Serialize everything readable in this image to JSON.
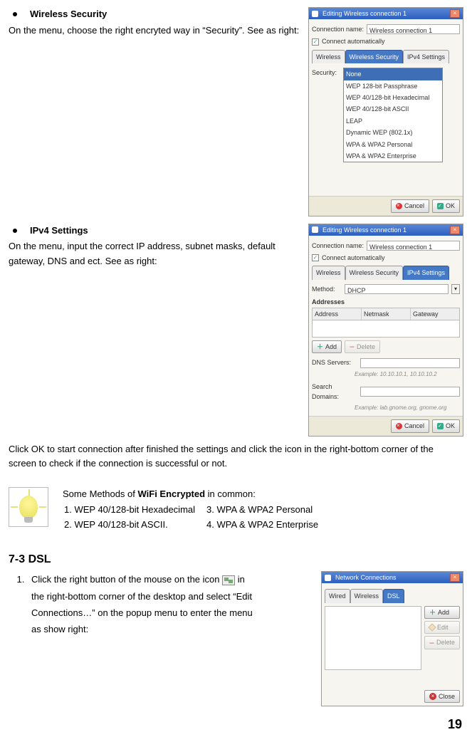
{
  "sec1": {
    "title": "Wireless Security",
    "para": "On the menu, choose the right encryted way in “Security”. See as right:",
    "shot": {
      "title": "Editing Wireless connection 1",
      "conn_label": "Connection name:",
      "conn_value": "Wireless connection 1",
      "auto": "Connect automatically",
      "tabs": [
        "Wireless",
        "Wireless Security",
        "IPv4 Settings"
      ],
      "sec_label": "Security:",
      "options": [
        "None",
        "WEP 128-bit Passphrase",
        "WEP 40/128-bit Hexadecimal",
        "WEP 40/128-bit ASCII",
        "LEAP",
        "Dynamic WEP (802.1x)",
        "WPA & WPA2 Personal",
        "WPA & WPA2 Enterprise"
      ],
      "cancel": "Cancel",
      "ok": "OK"
    }
  },
  "sec2": {
    "title": "IPv4 Settings",
    "para": "On the menu, input the correct IP address, subnet masks, default gateway, DNS and ect. See as right:",
    "shot": {
      "title": "Editing Wireless connection 1",
      "conn_label": "Connection name:",
      "conn_value": "Wireless connection 1",
      "auto": "Connect automatically",
      "tabs": [
        "Wireless",
        "Wireless Security",
        "IPv4 Settings"
      ],
      "meth_label": "Method:",
      "meth_value": "DHCP",
      "addr_head": "Addresses",
      "cols": [
        "Address",
        "Netmask",
        "Gateway"
      ],
      "add": "Add",
      "del": "Delete",
      "dns_label": "DNS Servers:",
      "dns_ex": "Example: 10.10.10.1, 10.10.10.2",
      "sd_label": "Search Domains:",
      "sd_ex": "Example: lab.gnome.org, gnome.org",
      "cancel": "Cancel",
      "ok": "OK"
    }
  },
  "afterpara": "Click OK to start connection after finished the settings and click the icon in the right-bottom corner of the screen to check if the connection is successful or not.",
  "tip": {
    "intro_a": "Some Methods of ",
    "intro_b": "WiFi Encrypted",
    "intro_c": " in common:",
    "m1": "1. WEP 40/128-bit Hexadecimal",
    "m1b": "3. WPA & WPA2 Personal",
    "m2": "2. WEP 40/128-bit ASCII.",
    "m2b": "4. WPA & WPA2 Enterprise"
  },
  "dsl": {
    "head": "7-3 DSL",
    "step1_num": "1.",
    "step1_a": "Click the right button of the mouse on the icon ",
    "step1_b": " in the right-bottom corner of the desktop and select “Edit Connections…” on the popup menu to enter the menu as show right:",
    "shot": {
      "title": "Network Connections",
      "tabs": [
        "Wired",
        "Wireless",
        "DSL"
      ],
      "add": "Add",
      "edit": "Edit",
      "del": "Delete",
      "close": "Close"
    }
  },
  "page": "19"
}
